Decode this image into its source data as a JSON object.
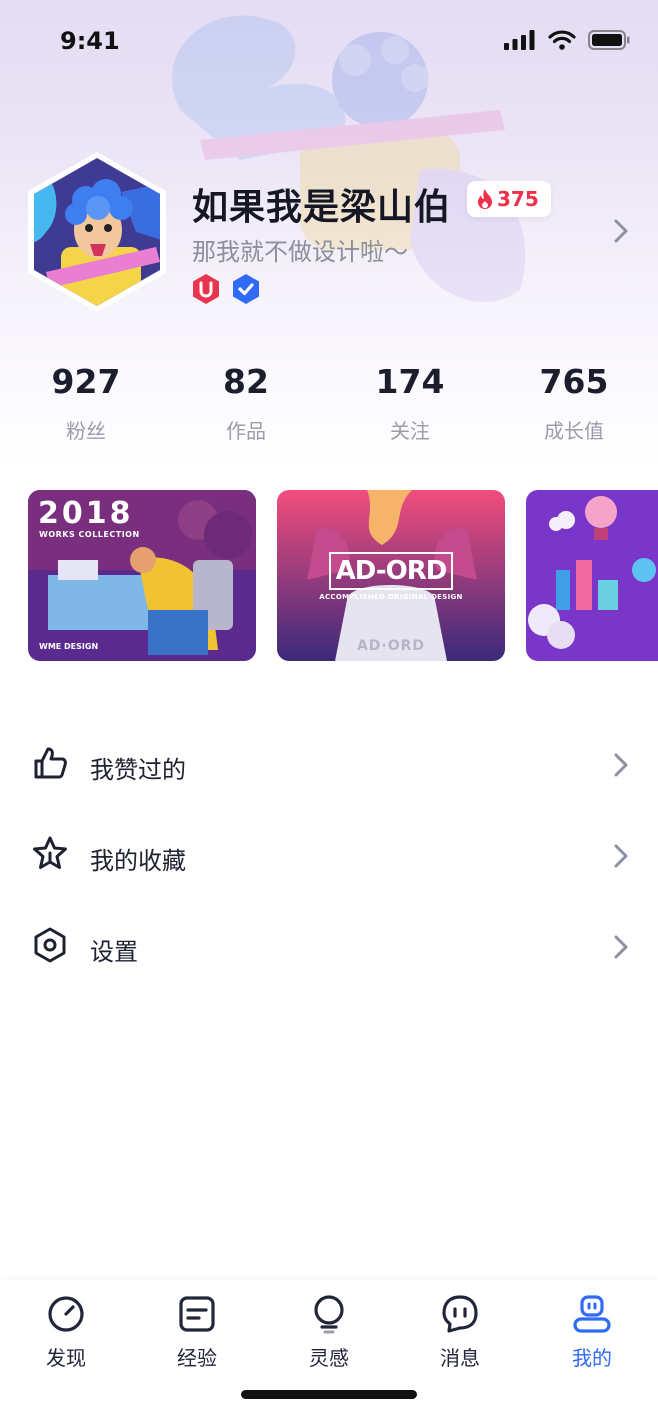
{
  "status_bar": {
    "time": "9:41"
  },
  "profile": {
    "name": "如果我是梁山伯",
    "heat": "375",
    "bio": "那我就不做设计啦～",
    "badges": [
      "u-badge-icon",
      "verified-icon"
    ]
  },
  "stats": [
    {
      "value": "927",
      "label": "粉丝"
    },
    {
      "value": "82",
      "label": "作品"
    },
    {
      "value": "174",
      "label": "关注"
    },
    {
      "value": "765",
      "label": "成长值"
    }
  ],
  "works": [
    {
      "year": "2018",
      "subtitle": "WORKS COLLECTION",
      "footer": "WME DESIGN"
    },
    {
      "title": "AD-ORD",
      "subtitle": "ACCOMPLISHED ORIGINAL DESIGN",
      "bottle_text": "AD·ORD"
    },
    {
      "title": ""
    }
  ],
  "menu": [
    {
      "label": "我赞过的",
      "icon": "thumbs-up-icon"
    },
    {
      "label": "我的收藏",
      "icon": "star-icon"
    },
    {
      "label": "设置",
      "icon": "settings-hexagon-icon"
    }
  ],
  "tabs": [
    {
      "label": "发现",
      "icon": "compass-icon"
    },
    {
      "label": "经验",
      "icon": "article-icon"
    },
    {
      "label": "灵感",
      "icon": "lightbulb-icon"
    },
    {
      "label": "消息",
      "icon": "message-icon"
    },
    {
      "label": "我的",
      "icon": "user-icon",
      "active": true
    }
  ],
  "colors": {
    "accent": "#2f6bf6",
    "heat": "#f0304a",
    "badge_red": "#e8344c",
    "badge_blue": "#2f6bf6"
  }
}
